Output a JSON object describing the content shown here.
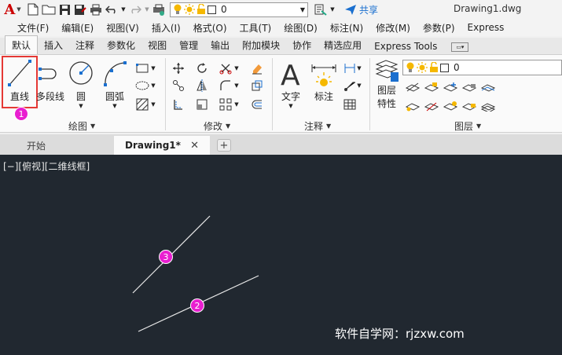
{
  "titlebar": {
    "logo_text": "A",
    "layer_value": "0",
    "share_label": "共享",
    "doc_title": "Drawing1.dwg"
  },
  "menu": [
    "文件(F)",
    "编辑(E)",
    "视图(V)",
    "插入(I)",
    "格式(O)",
    "工具(T)",
    "绘图(D)",
    "标注(N)",
    "修改(M)",
    "参数(P)",
    "Express"
  ],
  "ribbon_tabs": [
    "默认",
    "插入",
    "注释",
    "参数化",
    "视图",
    "管理",
    "输出",
    "附加模块",
    "协作",
    "精选应用",
    "Express Tools"
  ],
  "ribbon": {
    "draw": {
      "line_label": "直线",
      "polyline_label": "多段线",
      "circle_label": "圆",
      "arc_label": "圆弧",
      "panel_title": "绘图"
    },
    "modify": {
      "panel_title": "修改"
    },
    "annotation": {
      "text_label": "文字",
      "dim_label": "标注",
      "panel_title": "注释"
    },
    "layers": {
      "props_label_1": "图层",
      "props_label_2": "特性",
      "layer_value": "0",
      "panel_title": "图层"
    }
  },
  "doc_tabs": {
    "start": "开始",
    "active": "Drawing1*",
    "close": "✕",
    "add": "+"
  },
  "canvas": {
    "viewport_label": "[−][俯视][二维线框]",
    "watermark": "软件自学网：rjzxw.com"
  },
  "badges": [
    "1",
    "2",
    "3"
  ],
  "colors": {
    "accent_red": "#e53935",
    "badge": "#e91ed0",
    "canvas_bg": "#212830",
    "share_blue": "#1a6fcf",
    "bulb_yellow": "#f5b800"
  }
}
